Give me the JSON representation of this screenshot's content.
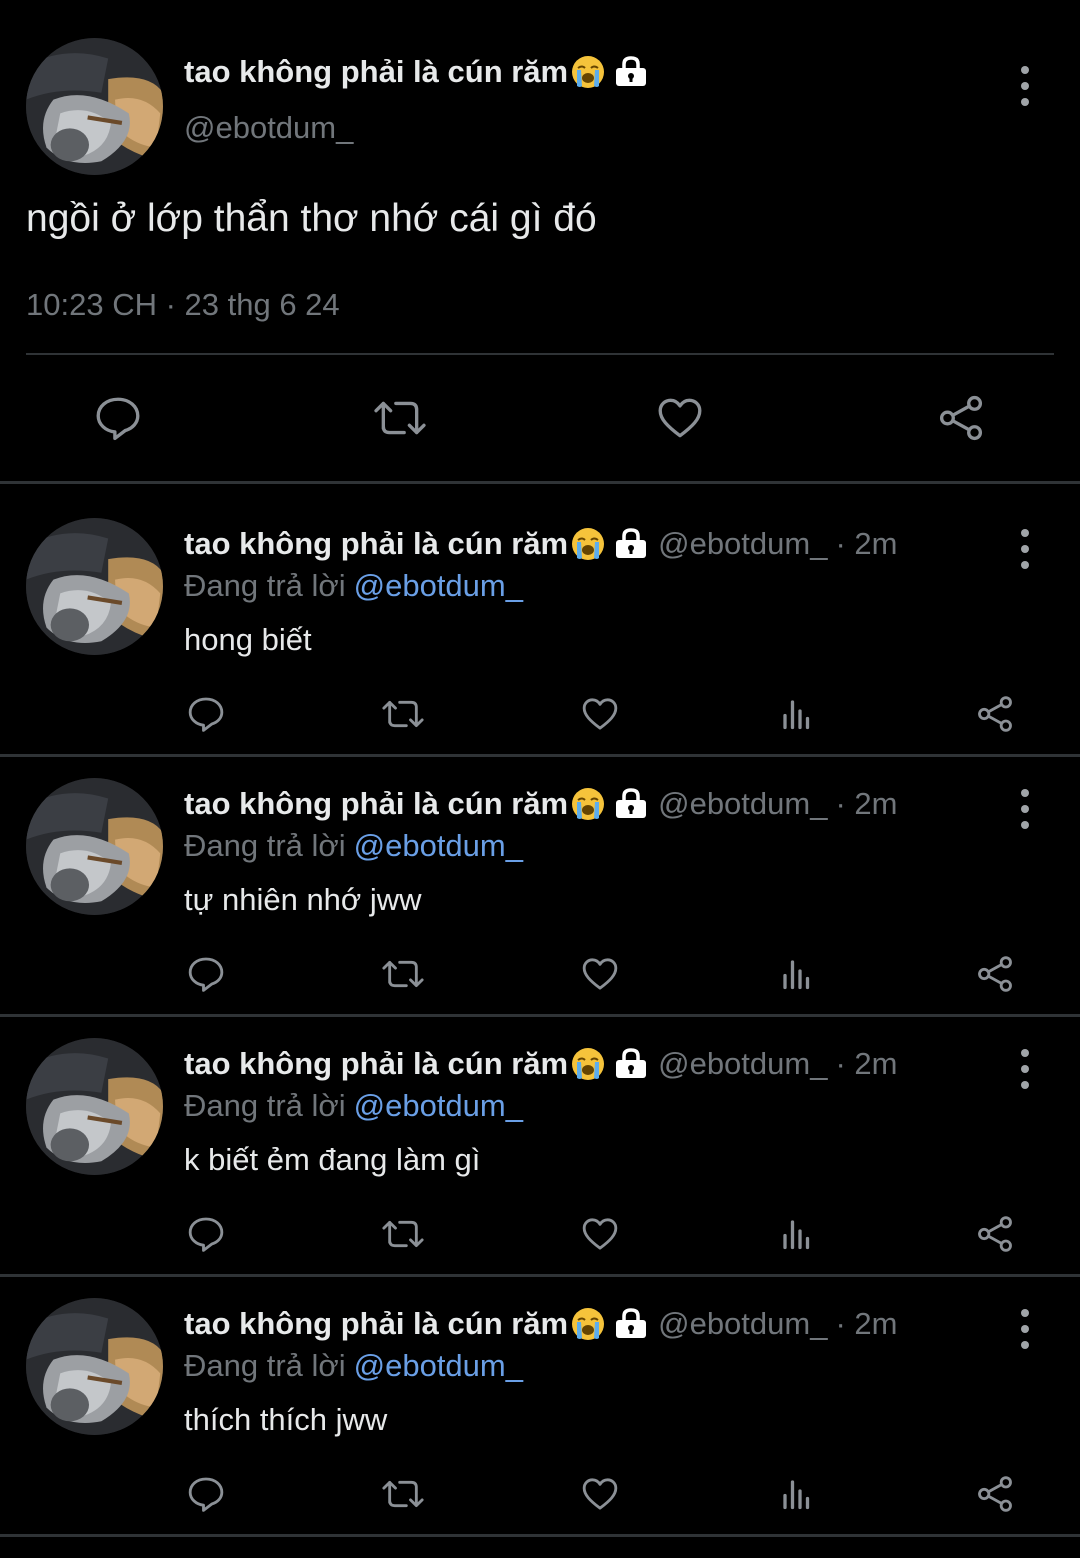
{
  "main_tweet": {
    "display_name": "tao không phải là cún răm",
    "handle": "@ebotdum_",
    "text": "ngồi ở lớp thẩn thơ nhớ cái gì đó",
    "timestamp": "10:23 CH · 23 thg 6 24",
    "actions": [
      "reply-icon",
      "retweet-icon",
      "like-icon",
      "share-icon"
    ]
  },
  "replies": [
    {
      "display_name": "tao không phải là cún răm",
      "handle": "@ebotdum_",
      "time": "· 2m",
      "replying_to_label": "Đang trả lời",
      "replying_to_handle": "@ebotdum_",
      "text": "hong biết"
    },
    {
      "display_name": "tao không phải là cún răm",
      "handle": "@ebotdum_",
      "time": "· 2m",
      "replying_to_label": "Đang trả lời",
      "replying_to_handle": "@ebotdum_",
      "text": "tự nhiên nhớ jww"
    },
    {
      "display_name": "tao không phải là cún răm",
      "handle": "@ebotdum_",
      "time": "· 2m",
      "replying_to_label": "Đang trả lời",
      "replying_to_handle": "@ebotdum_",
      "text": "k biết ẻm đang làm gì"
    },
    {
      "display_name": "tao không phải là cún răm",
      "handle": "@ebotdum_",
      "time": "· 2m",
      "replying_to_label": "Đang trả lời",
      "replying_to_handle": "@ebotdum_",
      "text": "thích thích jww"
    }
  ],
  "reply_actions": [
    "reply-icon",
    "retweet-icon",
    "like-icon",
    "views-icon",
    "share-icon"
  ],
  "colors": {
    "background": "#000000",
    "text": "#e7e9ea",
    "secondary": "#71767b",
    "mention": "#6a9fe6",
    "divider": "#2f3336"
  }
}
